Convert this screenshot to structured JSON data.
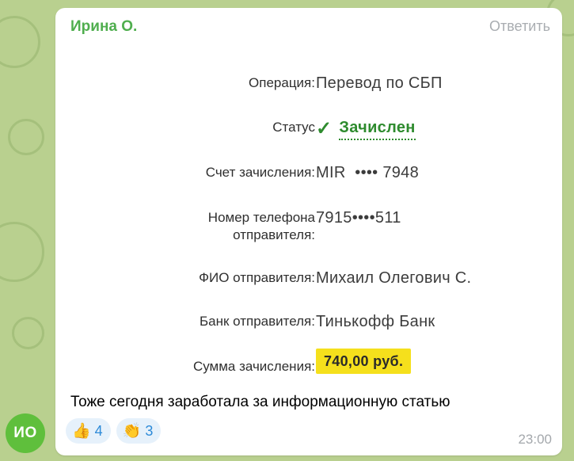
{
  "avatar": {
    "initials": "ИО",
    "color": "#5fbf3c"
  },
  "message": {
    "sender": "Ирина О.",
    "reply_label": "Ответить",
    "caption": "Тоже сегодня заработала за информационную статью",
    "time": "23:00",
    "reactions": [
      {
        "emoji": "👍",
        "count": "4"
      },
      {
        "emoji": "👏",
        "count": "3"
      }
    ]
  },
  "receipt": {
    "operation": {
      "label": "Операция:",
      "value": "Перевод по СБП"
    },
    "status": {
      "label": "Статус",
      "value": "Зачислен",
      "icon": "check-icon"
    },
    "account": {
      "label": "Счет зачисления:",
      "value": "MIR  •••• 7948"
    },
    "phone": {
      "label_line1": "Номер телефона",
      "label_line2": "отправителя:",
      "value": "7915••••511"
    },
    "sender_name": {
      "label": "ФИО отправителя:",
      "value": "Михаил Олегович С."
    },
    "bank": {
      "label": "Банк отправителя:",
      "value": "Тинькофф Банк"
    },
    "amount": {
      "label": "Сумма зачисления:",
      "value": "740,00 руб."
    }
  },
  "colors": {
    "sender_name": "#4fae4e",
    "status_green": "#2e8b2e",
    "amount_highlight": "#f5e01c",
    "reaction_bg": "#e6f1fb",
    "reaction_count": "#2d8ad8",
    "wallpaper": "#b9d08f"
  }
}
